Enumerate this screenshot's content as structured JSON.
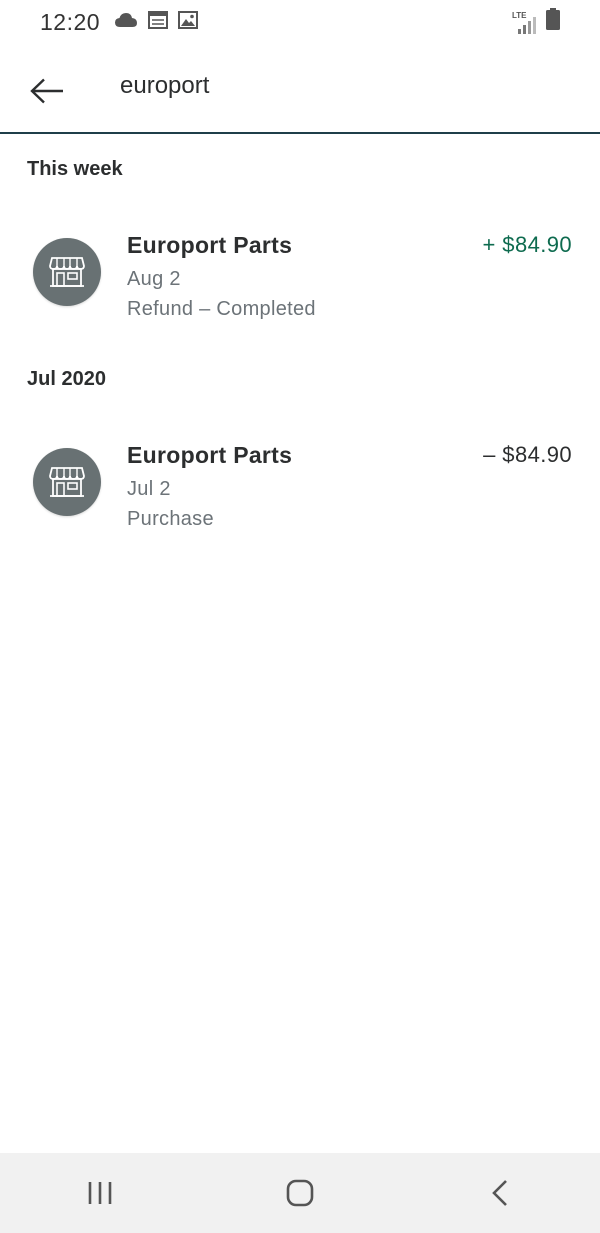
{
  "status_bar": {
    "time": "12:20",
    "network_label": "LTE",
    "left_icons": [
      "cloud-icon",
      "calendar-icon",
      "image-icon"
    ],
    "right_icons": [
      "signal-icon",
      "battery-icon"
    ]
  },
  "app_bar": {
    "back_icon": "arrow-left-icon",
    "search_query": "europort"
  },
  "sections": [
    {
      "header": "This week",
      "transactions": [
        {
          "merchant": "Europort Parts",
          "date": "Aug 2",
          "status": "Refund – Completed",
          "amount": "+ $84.90",
          "amount_color": "#0e6b4f",
          "icon": "storefront-icon"
        }
      ]
    },
    {
      "header": "Jul 2020",
      "transactions": [
        {
          "merchant": "Europort Parts",
          "date": "Jul 2",
          "status": "Purchase",
          "amount": "– $84.90",
          "amount_color": "#2c2e2f",
          "icon": "storefront-icon"
        }
      ]
    }
  ],
  "nav_bar": {
    "buttons": [
      "recent-apps-icon",
      "home-icon",
      "back-icon"
    ]
  }
}
